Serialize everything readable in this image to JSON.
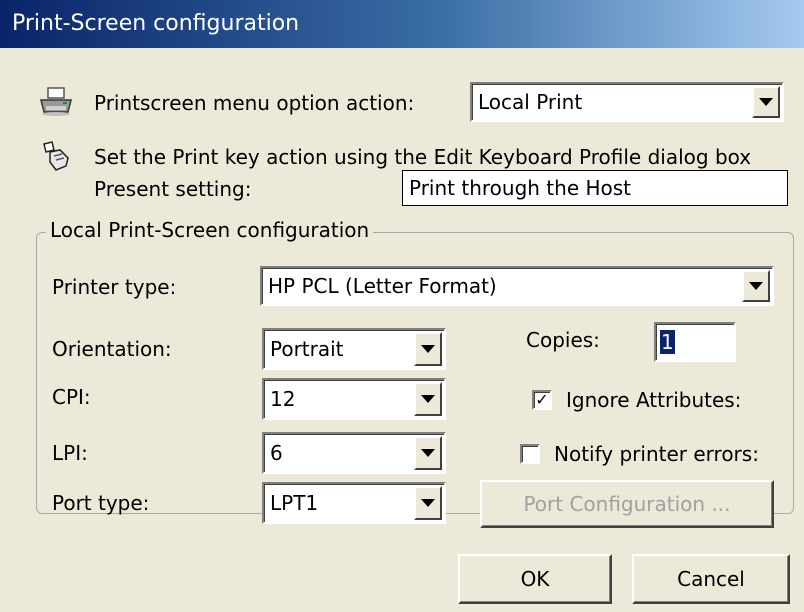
{
  "window": {
    "title": "Print-Screen configuration"
  },
  "menu_option": {
    "label": "Printscreen menu option action:",
    "value": "Local Print",
    "icon": "printer-icon"
  },
  "print_key": {
    "note": "Set the Print key action using the Edit Keyboard Profile dialog box",
    "present_label": "Present setting:",
    "present_value": "Print through the Host",
    "icon": "keyboard-hand-icon"
  },
  "local_group": {
    "title": "Local Print-Screen configuration",
    "printer_type": {
      "label": "Printer type:",
      "value": "HP PCL (Letter Format)"
    },
    "orientation": {
      "label": "Orientation:",
      "value": "Portrait"
    },
    "cpi": {
      "label": "CPI:",
      "value": "12"
    },
    "lpi": {
      "label": "LPI:",
      "value": "6"
    },
    "port_type": {
      "label": "Port type:",
      "value": "LPT1"
    },
    "copies": {
      "label": "Copies:",
      "value": "1"
    },
    "ignore_attributes": {
      "label": "Ignore Attributes:",
      "checked": true
    },
    "notify_errors": {
      "label": "Notify printer errors:",
      "checked": false
    },
    "port_config_button": "Port Configuration ..."
  },
  "buttons": {
    "ok": "OK",
    "cancel": "Cancel"
  },
  "colors": {
    "title_start": "#0a246a",
    "title_end": "#a6caf0",
    "face": "#ece9d8"
  }
}
